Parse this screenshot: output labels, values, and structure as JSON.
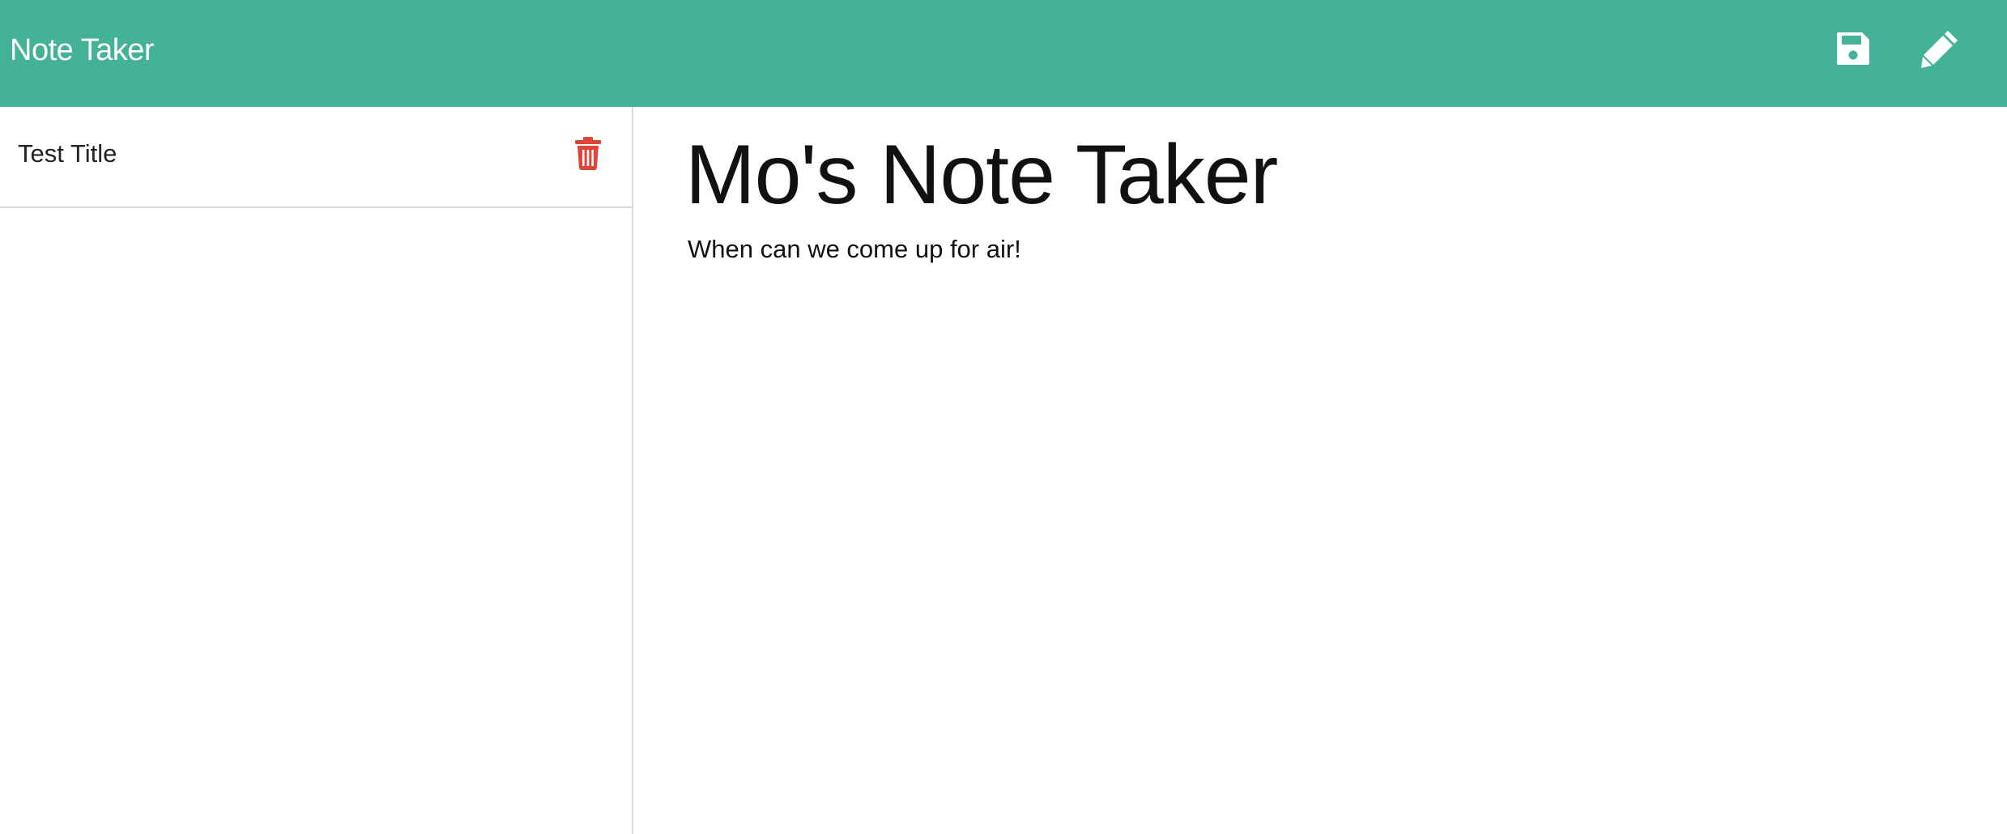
{
  "navbar": {
    "brand": "Note Taker",
    "color": "#43b296",
    "save_icon": "save-icon",
    "edit_icon": "pencil-icon"
  },
  "sidebar": {
    "notes": [
      {
        "title": "Test Title",
        "delete_icon": "trash-icon",
        "delete_color": "#e0453a"
      }
    ]
  },
  "main": {
    "title": "Mo's Note Taker",
    "body": "When can we come up for air!"
  }
}
